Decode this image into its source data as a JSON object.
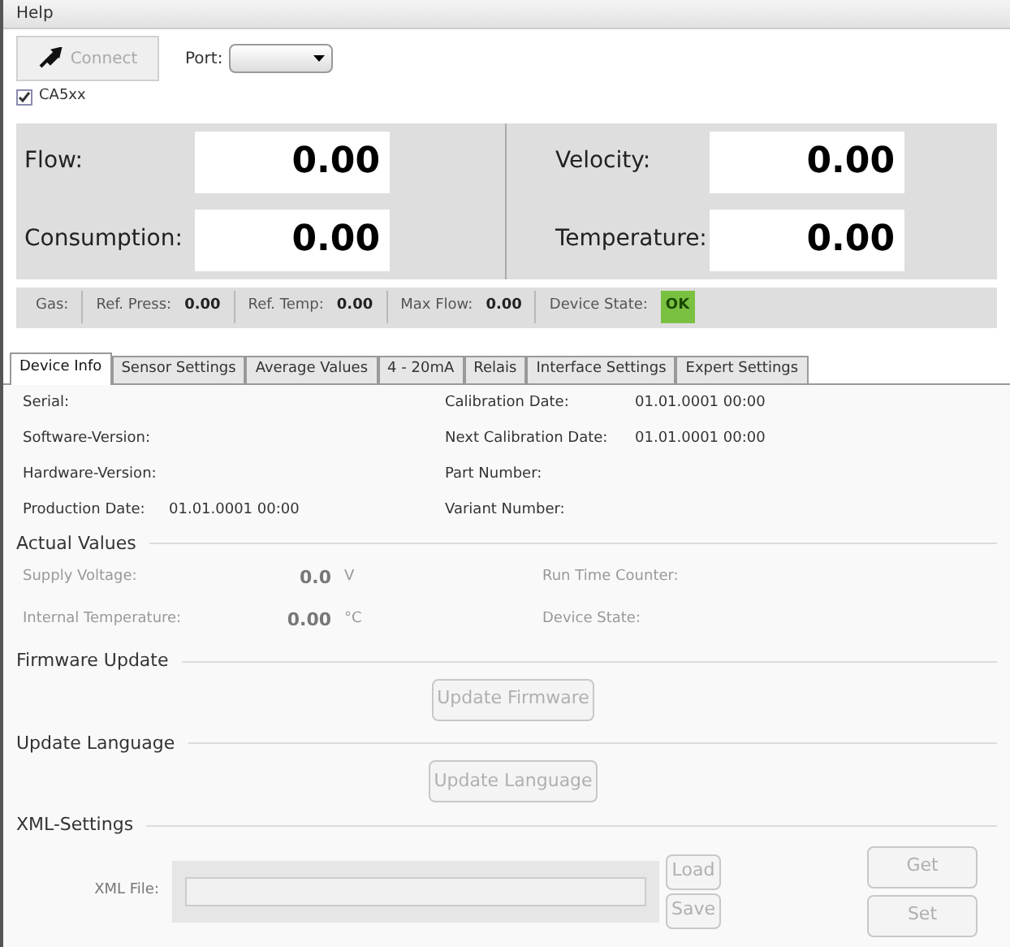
{
  "menu": [
    "Help"
  ],
  "toolbar": {
    "connect": {
      "label": "Connect",
      "disabled": true
    },
    "port_label": "Port:",
    "model": {
      "label": "CA5xx",
      "checked": true
    }
  },
  "readings": [
    {
      "label": "Flow:",
      "value": "0.00"
    },
    {
      "label": "Velocity:",
      "value": "0.00"
    },
    {
      "label": "Consumption:",
      "value": "0.00"
    },
    {
      "label": "Temperature:",
      "value": "0.00"
    }
  ],
  "status_bar": [
    {
      "label": "Gas:"
    },
    {
      "label": "Ref. Press:",
      "value": "0.00"
    },
    {
      "label": "Ref. Temp:",
      "value": "0.00"
    },
    {
      "label": "Max Flow:",
      "value": "0.00"
    },
    {
      "label": "Device State:",
      "badge": "OK",
      "color": "#7ac142"
    }
  ],
  "tabs": [
    {
      "label": "Device Info",
      "selected": true
    },
    {
      "label": "Sensor Settings",
      "selected": false
    },
    {
      "label": "Average Values",
      "selected": false
    },
    {
      "label": "4 - 20mA",
      "selected": false
    },
    {
      "label": "Relais",
      "selected": false
    },
    {
      "label": "Interface Settings",
      "selected": false
    },
    {
      "label": "Expert Settings",
      "selected": false
    }
  ],
  "device_info": [
    {
      "label": "Serial:"
    },
    {
      "label": "Calibration Date:",
      "value": "01.01.0001 00:00"
    },
    {
      "label": "Software-Version:"
    },
    {
      "label": "Next Calibration Date:",
      "value": "01.01.0001 00:00"
    },
    {
      "label": "Hardware-Version:"
    },
    {
      "label": "Part Number:"
    },
    {
      "label": "Production Date:",
      "value": "01.01.0001 00:00"
    },
    {
      "label": "Variant Number:"
    }
  ],
  "actual_values": {
    "title": "Actual Values",
    "rows": [
      {
        "label": "Supply Voltage:",
        "value": "0.0",
        "unit": "V",
        "right": "Run Time Counter:"
      },
      {
        "label": "Internal Temperature:",
        "value": "0.00",
        "unit": "°C",
        "right": "Device State:"
      }
    ]
  },
  "firmware_update": {
    "title": "Firmware Update",
    "button": {
      "label": "Update Firmware",
      "disabled": true
    }
  },
  "update_language": {
    "title": "Update Language",
    "button": {
      "label": "Update Language",
      "disabled": true
    }
  },
  "xml_settings": {
    "title": "XML-Settings",
    "file_label": "XML File:",
    "buttons": [
      {
        "label": "Load",
        "disabled": true
      },
      {
        "label": "Save",
        "disabled": true
      }
    ],
    "side_buttons": [
      {
        "label": "Get",
        "disabled": true
      },
      {
        "label": "Set",
        "disabled": true
      }
    ]
  }
}
